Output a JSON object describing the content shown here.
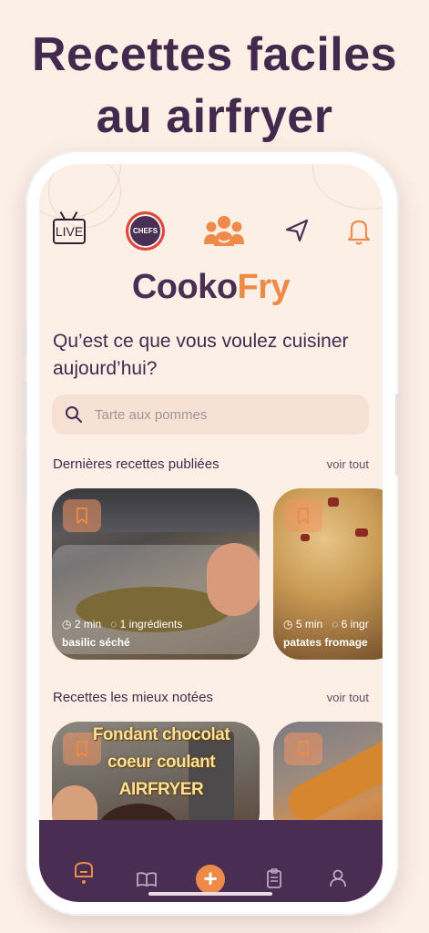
{
  "headline": {
    "line1": "Recettes faciles",
    "line2": "au airfryer"
  },
  "topbar": {
    "live_label": "LIVE",
    "chefs_label": "CHEFS",
    "icons": [
      "live-tv-icon",
      "chefs-avatar",
      "community-icon",
      "send-icon",
      "bell-icon"
    ]
  },
  "logo": {
    "part1": "Cooko",
    "part2": "Fry"
  },
  "question": "Qu’est ce que vous voulez cuisiner aujourd’hui?",
  "search": {
    "placeholder": "Tarte aux pommes"
  },
  "latest": {
    "title": "Dernières recettes publiées",
    "see_all": "voir tout",
    "cards": [
      {
        "time": "2 min",
        "ingredients": "1 ingrédients",
        "name": "basilic séché"
      },
      {
        "time": "5 min",
        "ingredients": "6 ingr",
        "name": "patates fromage"
      }
    ]
  },
  "top_rated": {
    "title": "Recettes les mieux notées",
    "see_all": "voir tout",
    "cards": [
      {
        "overlay_lines": [
          "Fondant chocolat",
          "coeur coulant",
          "AIRFRYER"
        ]
      },
      {}
    ]
  },
  "nav": [
    "home-icon",
    "book-icon",
    "plus-icon",
    "clipboard-icon",
    "profile-icon"
  ],
  "colors": {
    "accent": "#ec8a47",
    "brand": "#4a2f55",
    "background": "#fcefe6"
  }
}
